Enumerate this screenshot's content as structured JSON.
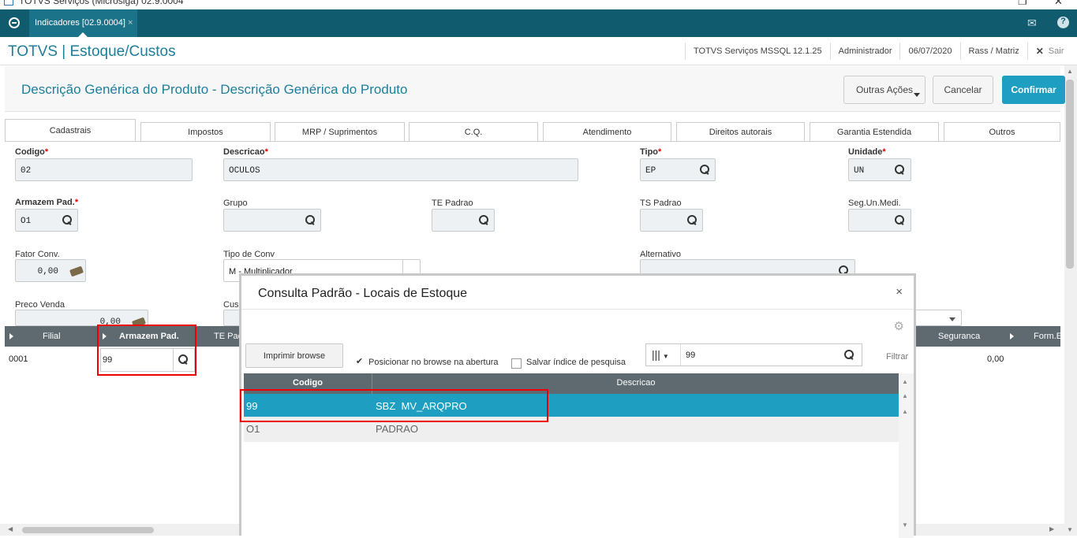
{
  "window": {
    "title": "TOTVS Serviços (Microsiga) 02.9.0004"
  },
  "topbar": {
    "tab_label": "Indicadores [02.9.0004]",
    "tab_close": "×",
    "mail_icon": "mail-icon",
    "help_icon": "help-icon"
  },
  "module": {
    "title": "TOTVS | Estoque/Custos",
    "server": "TOTVS Serviços MSSQL 12.1.25",
    "user": "Administrador",
    "date": "06/07/2020",
    "branch": "Rass / Matriz",
    "exit": "Sair"
  },
  "page": {
    "title": "Descrição Genérica do Produto - Descrição Genérica do Produto",
    "more_actions": "Outras Ações",
    "cancel": "Cancelar",
    "confirm": "Confirmar"
  },
  "tabs": [
    "Cadastrais",
    "Impostos",
    "MRP / Suprimentos",
    "C.Q.",
    "Atendimento",
    "Direitos autorais",
    "Garantia Estendida",
    "Outros"
  ],
  "form": {
    "codigo": {
      "label": "Codigo",
      "value": "02"
    },
    "descricao": {
      "label": "Descricao",
      "value": "OCULOS"
    },
    "tipo": {
      "label": "Tipo",
      "value": "EP"
    },
    "unidade": {
      "label": "Unidade",
      "value": "UN"
    },
    "armazem": {
      "label": "Armazem Pad.",
      "value": "O1"
    },
    "grupo": {
      "label": "Grupo"
    },
    "te_padrao": {
      "label": "TE Padrao"
    },
    "ts_padrao": {
      "label": "TS Padrao"
    },
    "seg_un": {
      "label": "Seg.Un.Medi."
    },
    "fator": {
      "label": "Fator Conv.",
      "value": "0,00"
    },
    "tipo_conv": {
      "label": "Tipo de Conv",
      "value": "M - Multiplicador"
    },
    "alternativo": {
      "label": "Alternativo"
    },
    "preco_venda": {
      "label": "Preco Venda",
      "value": "0,00"
    },
    "custo_label": "Cus"
  },
  "grid": {
    "headers": {
      "filial": "Filial",
      "armazem": "Armazem Pad.",
      "te": "TE Pad",
      "seguranca": "Seguranca",
      "form": "Form.E"
    },
    "row": {
      "filial": "0001",
      "armazem": "99",
      "seguranca": "0,00"
    }
  },
  "dialog": {
    "title": "Consulta Padrão - Locais de Estoque",
    "close": "×",
    "print_button": "Imprimir browse",
    "position_check": "Posicionar no browse na abertura",
    "position_checked": true,
    "save_index_check": "Salvar índice de pesquisa",
    "search_value": "99",
    "filter": "Filtrar",
    "columns": [
      "Codigo",
      "Descricao"
    ],
    "rows": [
      {
        "codigo": "99",
        "descricao": "SBZ  MV_ARQPRO"
      },
      {
        "codigo": "O1",
        "descricao": "PADRAO"
      }
    ]
  },
  "colors": {
    "topbar": "#105b6e",
    "accent": "#1e9fc2",
    "grid_header": "#5f6a70",
    "highlight": "#e00000"
  }
}
